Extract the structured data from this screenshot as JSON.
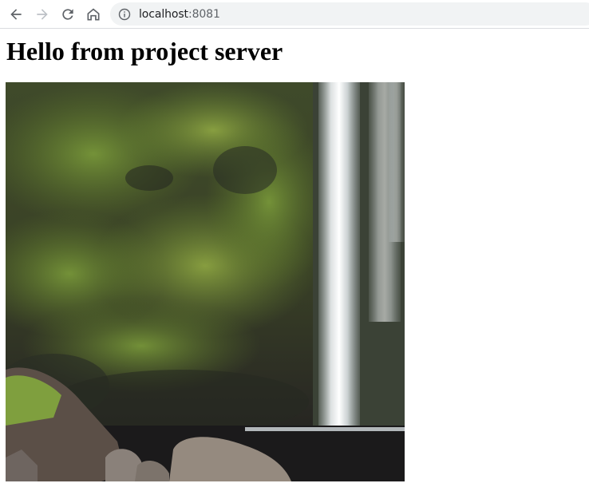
{
  "browser": {
    "url_host": "localhost",
    "url_port": ":8081",
    "icons": {
      "back": "arrow-left-icon",
      "forward": "arrow-right-icon",
      "reload": "reload-icon",
      "home": "home-icon",
      "site_info": "info-icon"
    }
  },
  "page": {
    "heading": "Hello from project server",
    "image_subject": "waterfall"
  },
  "colors": {
    "toolbar_bg": "#ffffff",
    "omnibox_bg": "#f1f3f4",
    "icon_active": "#5f6368",
    "icon_disabled": "#bdc1c6"
  }
}
